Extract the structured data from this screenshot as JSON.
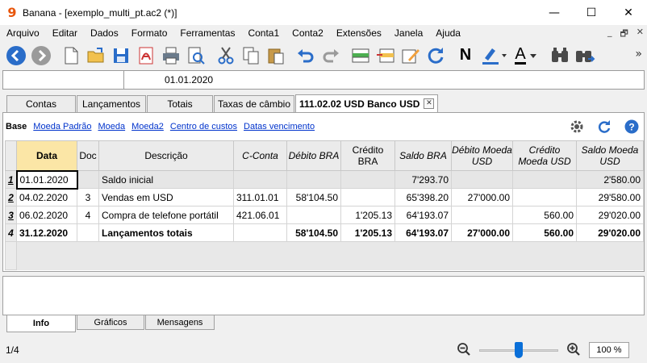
{
  "window": {
    "title": "Banana - [exemplo_multi_pt.ac2 (*)]",
    "app_icon_glyph": "9",
    "minimize": "—",
    "maximize": "☐",
    "close": "✕"
  },
  "menu": {
    "items": [
      "Arquivo",
      "Editar",
      "Dados",
      "Formato",
      "Ferramentas",
      "Conta1",
      "Conta2",
      "Extensões",
      "Janela",
      "Ajuda"
    ],
    "mdi_controls": [
      "_",
      "🗗",
      "✕"
    ]
  },
  "toolbar": {
    "icons": [
      "back-icon",
      "forward-icon",
      "new-file-icon",
      "open-folder-icon",
      "save-icon",
      "pdf-icon",
      "print-icon",
      "print-preview-icon",
      "cut-icon",
      "copy-icon",
      "paste-icon",
      "undo-icon",
      "redo-icon",
      "add-rows-icon",
      "delete-rows-icon",
      "edit-icon",
      "recalculate-icon",
      "bold-icon",
      "highlight-icon",
      "font-color-icon",
      "find-icon",
      "find-next-icon"
    ],
    "bold_label": "N",
    "font_color_label": "A",
    "more": "»"
  },
  "cellbar": {
    "value": "01.01.2020"
  },
  "tabs": [
    {
      "label": "Contas"
    },
    {
      "label": "Lançamentos"
    },
    {
      "label": "Totais"
    },
    {
      "label": "Taxas de câmbio"
    },
    {
      "label": "111.02.02 USD Banco USD",
      "active": true,
      "close": "✕"
    }
  ],
  "views": [
    {
      "label": "Base",
      "active": true
    },
    {
      "label": "Moeda Padrão"
    },
    {
      "label": "Moeda"
    },
    {
      "label": "Moeda2"
    },
    {
      "label": "Centro de custos"
    },
    {
      "label": "Datas vencimento"
    }
  ],
  "table": {
    "headers": [
      "",
      "Data",
      "Doc",
      "Descrição",
      "C-Conta",
      "Débito BRA",
      "Crédito BRA",
      "Saldo BRA",
      "Débito Moeda USD",
      "Crédito Moeda USD",
      "Saldo Moeda USD"
    ],
    "rows": [
      [
        "1",
        "01.01.2020",
        "",
        "Saldo inicial",
        "",
        "",
        "",
        "7'293.70",
        "",
        "",
        "2'580.00"
      ],
      [
        "2",
        "04.02.2020",
        "3",
        "Vendas em USD",
        "311.01.01",
        "58'104.50",
        "",
        "65'398.20",
        "27'000.00",
        "",
        "29'580.00"
      ],
      [
        "3",
        "06.02.2020",
        "4",
        "Compra de telefone portátil",
        "421.06.01",
        "",
        "1'205.13",
        "64'193.07",
        "",
        "560.00",
        "29'020.00"
      ],
      [
        "4",
        "31.12.2020",
        "",
        "Lançamentos totais",
        "",
        "58'104.50",
        "1'205.13",
        "64'193.07",
        "27'000.00",
        "560.00",
        "29'020.00"
      ]
    ]
  },
  "bottom_tabs": [
    {
      "label": "Info",
      "active": true
    },
    {
      "label": "Gráficos"
    },
    {
      "label": "Mensagens"
    }
  ],
  "status": {
    "position": "1/4",
    "zoom": "100 %",
    "zoom_level": 0.5
  },
  "colors": {
    "accent": "#2a6dc9",
    "date_header": "#fbe6a6",
    "app_icon": "#e8560c"
  }
}
